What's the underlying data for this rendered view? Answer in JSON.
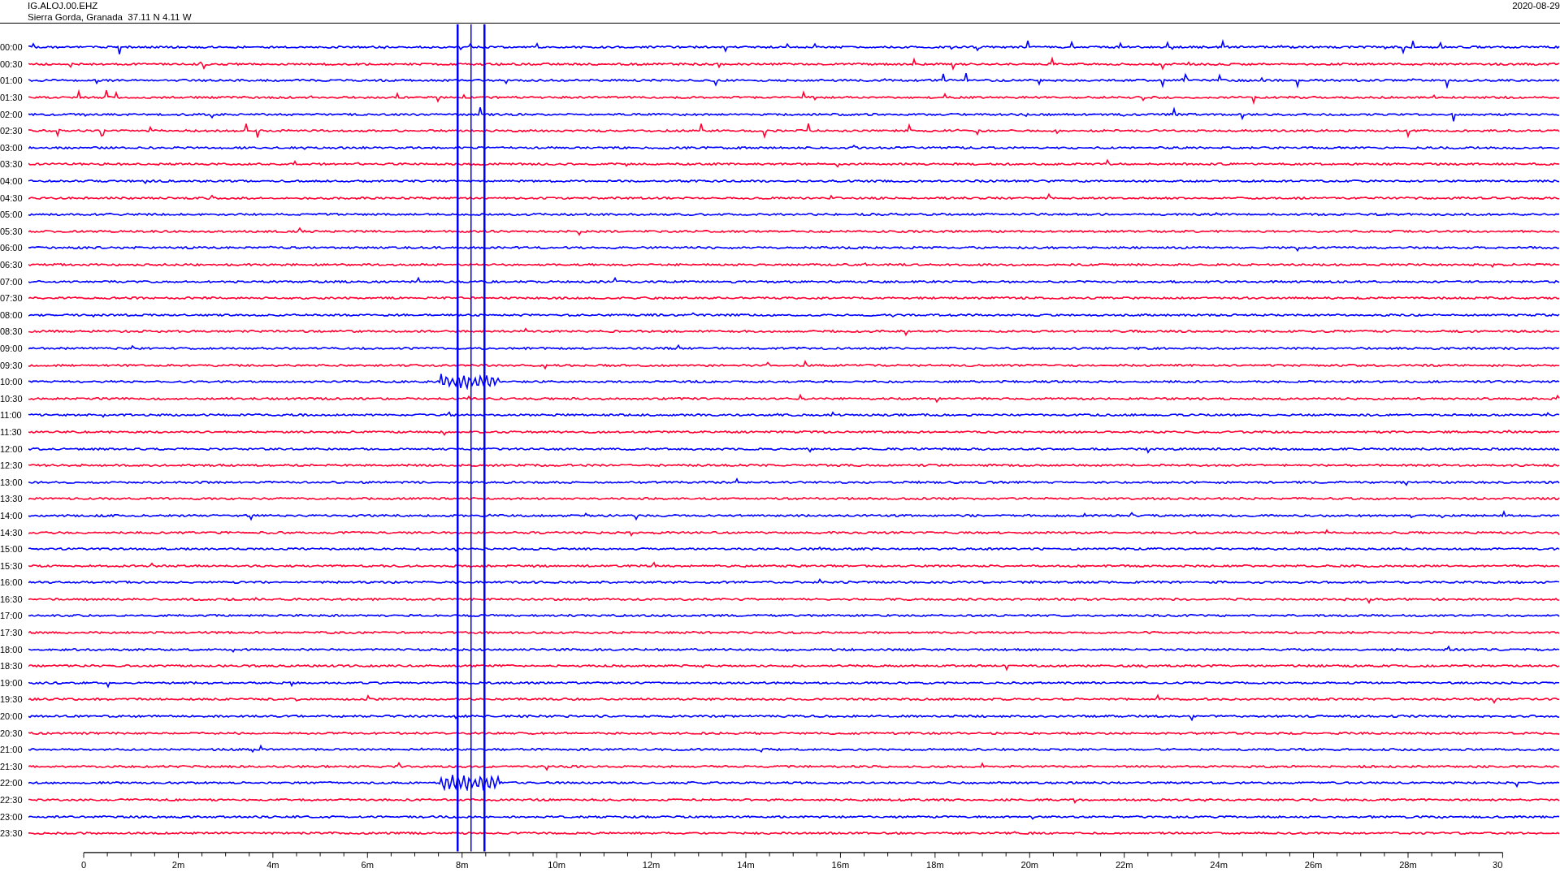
{
  "header": {
    "station": "IG.ALOJ.00.EHZ",
    "location": "Sierra Gorda, Granada  37.11 N 4.11 W",
    "date": "2020-08-29"
  },
  "rows": [
    {
      "time": "00:00",
      "color": "#0000ff"
    },
    {
      "time": "00:30",
      "color": "#ff0033"
    },
    {
      "time": "01:00",
      "color": "#0000ff"
    },
    {
      "time": "01:30",
      "color": "#ff0033"
    },
    {
      "time": "02:00",
      "color": "#0000ff"
    },
    {
      "time": "02:30",
      "color": "#ff0033"
    },
    {
      "time": "03:00",
      "color": "#0000ff"
    },
    {
      "time": "03:30",
      "color": "#ff0033"
    },
    {
      "time": "04:00",
      "color": "#0000ff"
    },
    {
      "time": "04:30",
      "color": "#ff0033"
    },
    {
      "time": "05:00",
      "color": "#0000ff"
    },
    {
      "time": "05:30",
      "color": "#ff0033"
    },
    {
      "time": "06:00",
      "color": "#0000ff"
    },
    {
      "time": "06:30",
      "color": "#ff0033"
    },
    {
      "time": "07:00",
      "color": "#0000ff"
    },
    {
      "time": "07:30",
      "color": "#ff0033"
    },
    {
      "time": "08:00",
      "color": "#0000ff"
    },
    {
      "time": "08:30",
      "color": "#ff0033"
    },
    {
      "time": "09:00",
      "color": "#0000ff"
    },
    {
      "time": "09:30",
      "color": "#ff0033"
    },
    {
      "time": "10:00",
      "color": "#0000ff"
    },
    {
      "time": "10:30",
      "color": "#ff0033"
    },
    {
      "time": "11:00",
      "color": "#0000ff"
    },
    {
      "time": "11:30",
      "color": "#ff0033"
    },
    {
      "time": "12:00",
      "color": "#0000ff"
    },
    {
      "time": "12:30",
      "color": "#ff0033"
    },
    {
      "time": "13:00",
      "color": "#0000ff"
    },
    {
      "time": "13:30",
      "color": "#ff0033"
    },
    {
      "time": "14:00",
      "color": "#0000ff"
    },
    {
      "time": "14:30",
      "color": "#ff0033"
    },
    {
      "time": "15:00",
      "color": "#0000ff"
    },
    {
      "time": "15:30",
      "color": "#ff0033"
    },
    {
      "time": "16:00",
      "color": "#0000ff"
    },
    {
      "time": "16:30",
      "color": "#ff0033"
    },
    {
      "time": "17:00",
      "color": "#0000ff"
    },
    {
      "time": "17:30",
      "color": "#ff0033"
    },
    {
      "time": "18:00",
      "color": "#0000ff"
    },
    {
      "time": "18:30",
      "color": "#ff0033"
    },
    {
      "time": "19:00",
      "color": "#0000ff"
    },
    {
      "time": "19:30",
      "color": "#ff0033"
    },
    {
      "time": "20:00",
      "color": "#0000ff"
    },
    {
      "time": "20:30",
      "color": "#ff0033"
    },
    {
      "time": "21:00",
      "color": "#0000ff"
    },
    {
      "time": "21:30",
      "color": "#ff0033"
    },
    {
      "time": "22:00",
      "color": "#0000ff"
    },
    {
      "time": "22:30",
      "color": "#ff0033"
    },
    {
      "time": "23:00",
      "color": "#0000ff"
    },
    {
      "time": "23:30",
      "color": "#ff0033"
    }
  ],
  "x_axis": {
    "ticks": [
      "0",
      "2m",
      "4m",
      "6m",
      "8m",
      "10m",
      "12m",
      "14m",
      "16m",
      "18m",
      "20m",
      "22m",
      "24m",
      "26m",
      "28m",
      "30"
    ]
  }
}
